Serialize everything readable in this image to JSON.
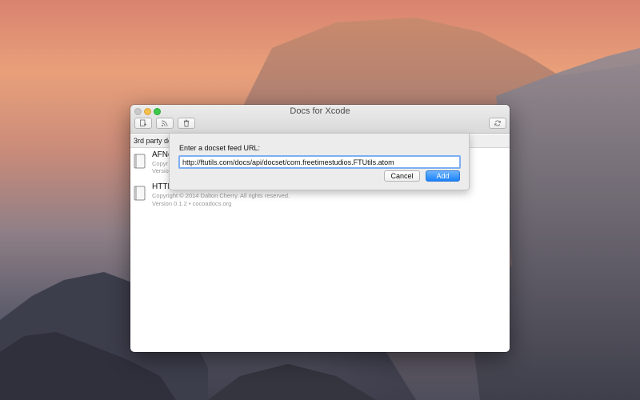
{
  "window": {
    "title": "Docs for Xcode"
  },
  "toolbar": {
    "add_icon": "add-docset-icon",
    "feed_icon": "rss-feed-icon",
    "trash_icon": "trash-icon",
    "refresh_icon": "refresh-icon"
  },
  "tabstrip": {
    "label": "3rd party doc"
  },
  "list": {
    "items": [
      {
        "name": "AFNe",
        "meta_line1": "Copyr",
        "meta_line2": "Versio"
      },
      {
        "name": "HTTP",
        "meta_line1": "Copyright © 2014 Dalton Cherry. All rights reserved.",
        "meta_line2": "Version 0.1.2 • cocoadocs.org"
      }
    ]
  },
  "sheet": {
    "prompt": "Enter a docset feed URL:",
    "url_value": "http://ftutils.com/docs/api/docset/com.freetimestudios.FTUtils.atom",
    "cancel_label": "Cancel",
    "add_label": "Add"
  },
  "colors": {
    "accent": "#1a82fb",
    "focus_ring": "#7eaef2",
    "minimize": "#f5bf4f",
    "zoom": "#3dc94b"
  }
}
